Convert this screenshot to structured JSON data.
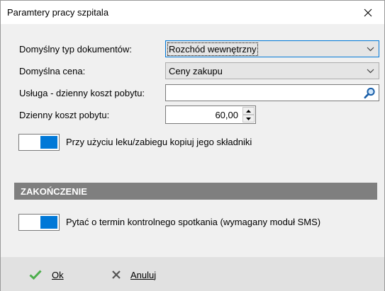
{
  "window": {
    "title": "Paramtery pracy szpitala"
  },
  "fields": {
    "doc_type": {
      "label": "Domyślny typ dokumentów:",
      "value": "Rozchód wewnętrzny"
    },
    "price": {
      "label": "Domyślna cena:",
      "value": "Ceny zakupu"
    },
    "service": {
      "label": "Usługa - dzienny koszt pobytu:",
      "value": ""
    },
    "daily_cost": {
      "label": "Dzienny koszt pobytu:",
      "value": "60,00"
    }
  },
  "toggles": {
    "copy_components": {
      "label": "Przy użyciu leku/zabiegu kopiuj jego składniki",
      "on": true
    },
    "ask_followup": {
      "label": "Pytać o termin kontrolnego spotkania (wymagany moduł SMS)",
      "on": true
    }
  },
  "section": {
    "title": "ZAKOŃCZENIE"
  },
  "footer": {
    "ok_label": "Ok",
    "cancel_label": "Anuluj"
  },
  "colors": {
    "accent": "#0078d7",
    "ok_check": "#4cae4c",
    "section_bg": "#7f7f7f"
  },
  "icons": {
    "close": "close-icon",
    "dropdown": "chevron-down-icon",
    "search": "search-icon",
    "ok": "check-icon",
    "cancel": "x-icon"
  }
}
